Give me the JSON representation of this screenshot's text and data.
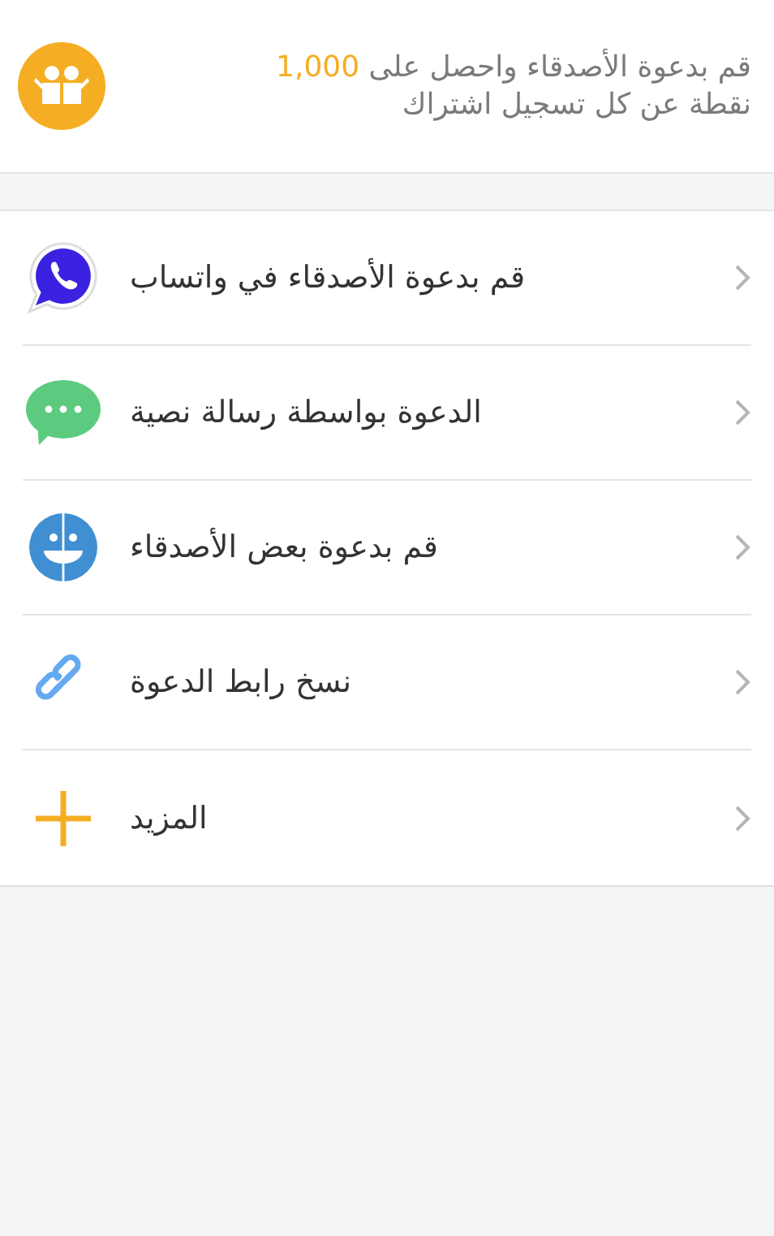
{
  "header": {
    "message_start": "قم بدعوة الأصدقاء واحصل على",
    "points": "1,000",
    "message_end": "نقطة عن كل تسجيل اشتراك"
  },
  "options": [
    {
      "kind": "whatsapp",
      "label": "قم بدعوة الأصدقاء في واتساب"
    },
    {
      "kind": "sms",
      "label": "الدعوة بواسطة رسالة نصية"
    },
    {
      "kind": "contacts",
      "label": "قم بدعوة بعض الأصدقاء"
    },
    {
      "kind": "link",
      "label": "نسخ رابط الدعوة"
    },
    {
      "kind": "more",
      "label": "المزيد"
    }
  ]
}
